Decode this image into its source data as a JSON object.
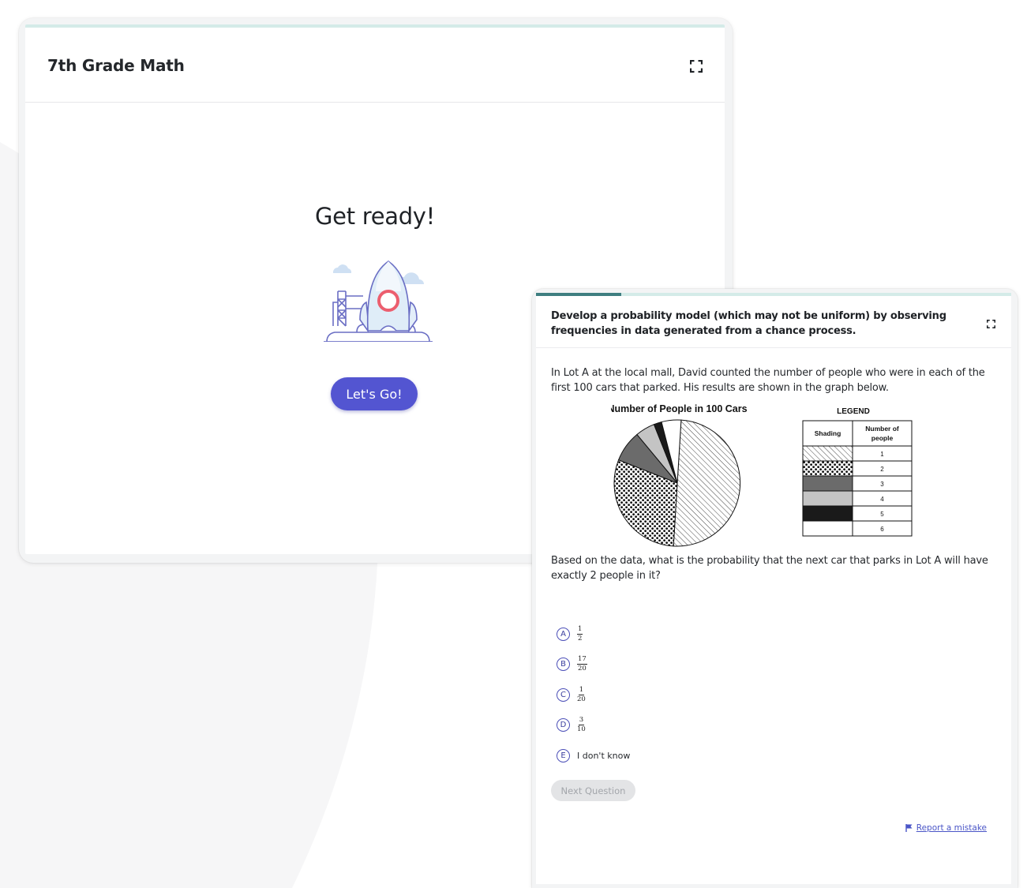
{
  "quiz_card": {
    "title": "7th Grade Math",
    "heading": "Get ready!",
    "start_button": "Let's Go!",
    "expand_icon": "expand-icon",
    "illustration": "rocket-launch-illustration"
  },
  "question_card": {
    "progress": 0.18,
    "standard": "Develop a probability model (which may not be uniform) by observing frequencies in data generated from a chance process.",
    "intro": "In Lot A at the local mall, David counted the number of people who were in each of the first 100 cars that parked. His results are shown in the graph below.",
    "prompt": "Based on the data, what is the probability that the next car that parks in Lot A will have exactly 2 people in it?",
    "choices": [
      {
        "letter": "A",
        "num": "1",
        "den": "2"
      },
      {
        "letter": "B",
        "num": "17",
        "den": "20"
      },
      {
        "letter": "C",
        "num": "1",
        "den": "20"
      },
      {
        "letter": "D",
        "num": "3",
        "den": "10"
      },
      {
        "letter": "E",
        "text": "I don't know"
      }
    ],
    "next_button": "Next Question",
    "report_link": "Report a mistake",
    "report_icon": "flag-icon",
    "accent_color": "#5355d1"
  },
  "chart_data": {
    "type": "pie",
    "title": "Number of People in 100 Cars",
    "categories": [
      "1",
      "2",
      "3",
      "4",
      "5",
      "6"
    ],
    "values": [
      50,
      30,
      8,
      5,
      2,
      5
    ],
    "legend": {
      "title": "LEGEND",
      "col_shading": "Shading",
      "col_people": "Number of people",
      "rows": [
        "1",
        "2",
        "3",
        "4",
        "5",
        "6"
      ]
    }
  }
}
